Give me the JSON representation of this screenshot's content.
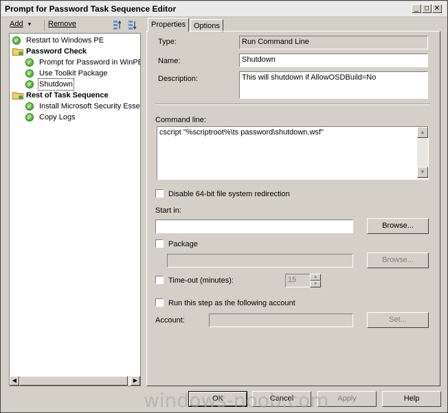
{
  "window": {
    "title": "Prompt for Password Task Sequence Editor",
    "controls": {
      "minimize": "_",
      "maximize": "□",
      "close": "✕"
    }
  },
  "toolbar": {
    "add_label": "Add",
    "add_arrow": "▾",
    "remove_label": "Remove",
    "move_up_icon": "move-up-icon",
    "move_down_icon": "move-down-icon"
  },
  "tree": {
    "items": [
      {
        "label": "Restart to Windows PE",
        "type": "step",
        "icon": "check-icon"
      },
      {
        "label": "Password Check",
        "type": "group",
        "icon": "folder-icon"
      },
      {
        "label": "Prompt for Password in WinPE",
        "type": "step",
        "icon": "check-icon"
      },
      {
        "label": "Use Toolkit Package",
        "type": "step",
        "icon": "check-icon"
      },
      {
        "label": "Shutdown",
        "type": "step",
        "icon": "check-icon",
        "selected": true
      },
      {
        "label": "Rest of Task Sequence",
        "type": "group",
        "icon": "folder-icon"
      },
      {
        "label": "Install Microsoft Security Essen",
        "type": "step",
        "icon": "check-icon"
      },
      {
        "label": "Copy Logs",
        "type": "step",
        "icon": "check-icon"
      }
    ]
  },
  "tabs": [
    {
      "label": "Properties",
      "active": true
    },
    {
      "label": "Options",
      "active": false
    }
  ],
  "properties": {
    "type_label": "Type:",
    "type_value": "Run Command Line",
    "name_label": "Name:",
    "name_value": "Shutdown",
    "description_label": "Description:",
    "description_value": "This will shutdown if AllowOSDBuild=No",
    "command_line_label": "Command line:",
    "command_line_value": "cscript \"%scriptroot%\\ts password\\shutdown.wsf\"",
    "disable64_label": "Disable 64-bit file system redirection",
    "start_in_label": "Start in:",
    "start_in_value": "",
    "browse_label": "Browse...",
    "package_label": "Package",
    "package_value": "",
    "package_browse_label": "Browse...",
    "timeout_label": "Time-out (minutes):",
    "timeout_value": "15",
    "run_as_label": "Run this step as the following account",
    "account_label": "Account:",
    "account_value": "",
    "set_label": "Set..."
  },
  "buttons": {
    "ok": "OK",
    "cancel": "Cancel",
    "apply": "Apply",
    "help": "Help"
  },
  "watermark": "windows-noob.com"
}
